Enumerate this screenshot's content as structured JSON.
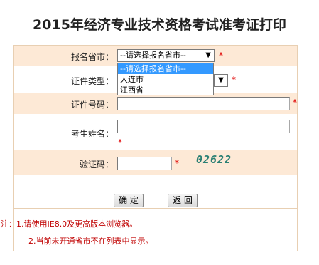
{
  "title": "2015年经济专业技术资格考试准考证打印",
  "form": {
    "province": {
      "label": "报名省市：",
      "value": "--请选择报名省市--",
      "required": "*",
      "options": [
        "--请选择报名省市--",
        "大连市",
        "江西省"
      ]
    },
    "id_type": {
      "label": "证件类型：",
      "required": "*"
    },
    "id_number": {
      "label": "证件号码：",
      "required": "*"
    },
    "name": {
      "label": "考生姓名：",
      "required": "*"
    },
    "captcha": {
      "label": "验证码：",
      "required": "*",
      "image_text": "02622"
    }
  },
  "buttons": {
    "confirm": "确 定",
    "back": "返 回"
  },
  "notes": {
    "line1": "注：1.请使用IE8.0及更高版本浏览器。",
    "line2": "2.当前未开通省市不在列表中显示。"
  },
  "colors": {
    "row_bg": "#fde9d6",
    "required": "#e00000",
    "note": "#c00000",
    "highlight": "#3399ff"
  }
}
